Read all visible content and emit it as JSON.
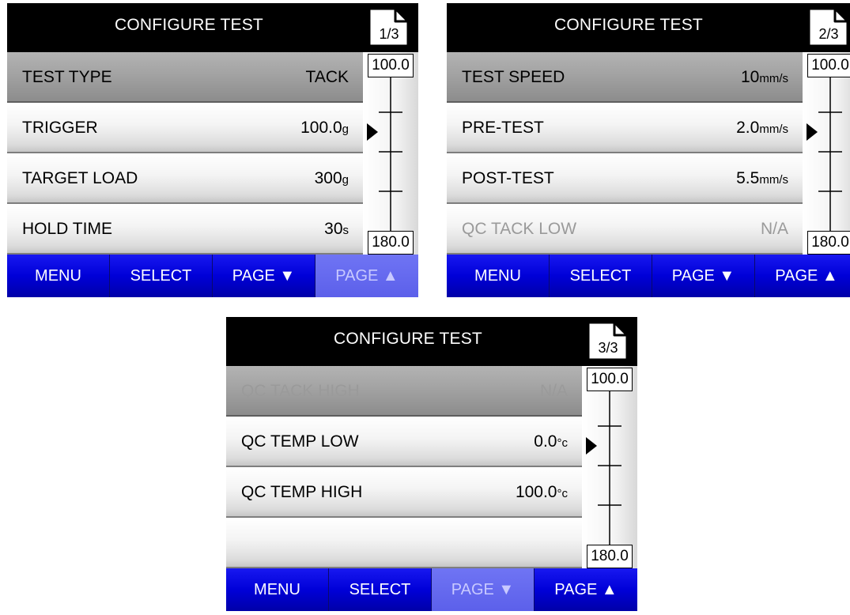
{
  "screens": [
    {
      "title": "CONFIGURE TEST",
      "page_indicator": "1/3",
      "rows": [
        {
          "label": "TEST TYPE",
          "value": "TACK",
          "unit": "",
          "selected": true,
          "disabled": false
        },
        {
          "label": "TRIGGER",
          "value": "100.0",
          "unit": "g",
          "selected": false,
          "disabled": false
        },
        {
          "label": "TARGET LOAD",
          "value": "300",
          "unit": "g",
          "selected": false,
          "disabled": false
        },
        {
          "label": "HOLD TIME",
          "value": "30",
          "unit": "s",
          "selected": false,
          "disabled": false
        }
      ],
      "gauge": {
        "top": "100.0",
        "bottom": "180.0"
      },
      "softkeys": [
        {
          "label": "MENU",
          "disabled": false
        },
        {
          "label": "SELECT",
          "disabled": false
        },
        {
          "label": "PAGE ▼",
          "disabled": false
        },
        {
          "label": "PAGE ▲",
          "disabled": true
        }
      ]
    },
    {
      "title": "CONFIGURE TEST",
      "page_indicator": "2/3",
      "rows": [
        {
          "label": "TEST SPEED",
          "value": "10",
          "unit": "mm/s",
          "selected": true,
          "disabled": false
        },
        {
          "label": "PRE-TEST",
          "value": "2.0",
          "unit": "mm/s",
          "selected": false,
          "disabled": false
        },
        {
          "label": "POST-TEST",
          "value": "5.5",
          "unit": "mm/s",
          "selected": false,
          "disabled": false
        },
        {
          "label": "QC TACK LOW",
          "value": "N/A",
          "unit": "",
          "selected": false,
          "disabled": true
        }
      ],
      "gauge": {
        "top": "100.0",
        "bottom": "180.0"
      },
      "softkeys": [
        {
          "label": "MENU",
          "disabled": false
        },
        {
          "label": "SELECT",
          "disabled": false
        },
        {
          "label": "PAGE ▼",
          "disabled": false
        },
        {
          "label": "PAGE ▲",
          "disabled": false
        }
      ]
    },
    {
      "title": "CONFIGURE TEST",
      "page_indicator": "3/3",
      "rows": [
        {
          "label": "QC TACK HIGH",
          "value": "N/A",
          "unit": "",
          "selected": true,
          "disabled": true
        },
        {
          "label": "QC TEMP LOW",
          "value": "0.0",
          "unit": "°c",
          "selected": false,
          "disabled": false
        },
        {
          "label": "QC TEMP HIGH",
          "value": "100.0",
          "unit": "°c",
          "selected": false,
          "disabled": false
        },
        {
          "label": "",
          "value": "",
          "unit": "",
          "selected": false,
          "disabled": false
        }
      ],
      "gauge": {
        "top": "100.0",
        "bottom": "180.0"
      },
      "softkeys": [
        {
          "label": "MENU",
          "disabled": false
        },
        {
          "label": "SELECT",
          "disabled": false
        },
        {
          "label": "PAGE ▼",
          "disabled": true
        },
        {
          "label": "PAGE ▲",
          "disabled": false
        }
      ]
    }
  ]
}
